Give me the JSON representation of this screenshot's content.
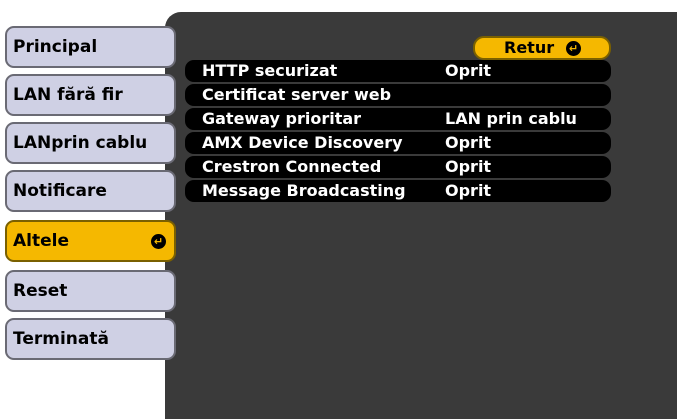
{
  "sidebar": {
    "items": [
      {
        "label": "Principal"
      },
      {
        "label": "LAN fără fir"
      },
      {
        "label": "LANprin cablu"
      },
      {
        "label": "Notificare"
      },
      {
        "label": "Altele",
        "selected": true
      },
      {
        "label": "Reset"
      },
      {
        "label": "Terminată"
      }
    ]
  },
  "return_button": {
    "label": "Retur",
    "icon": "enter-icon"
  },
  "settings": [
    {
      "label": "HTTP securizat",
      "value": "Oprit"
    },
    {
      "label": "Certificat server web",
      "value": ""
    },
    {
      "label": "Gateway prioritar",
      "value": "LAN prin cablu"
    },
    {
      "label": "AMX Device Discovery",
      "value": "Oprit"
    },
    {
      "label": "Crestron Connected",
      "value": "Oprit"
    },
    {
      "label": "Message Broadcasting",
      "value": "Oprit"
    }
  ],
  "colors": {
    "tab_background": "#cfd0e4",
    "selected_accent": "#f5b800",
    "panel_background": "#3a3a3a",
    "row_background": "#000000"
  }
}
